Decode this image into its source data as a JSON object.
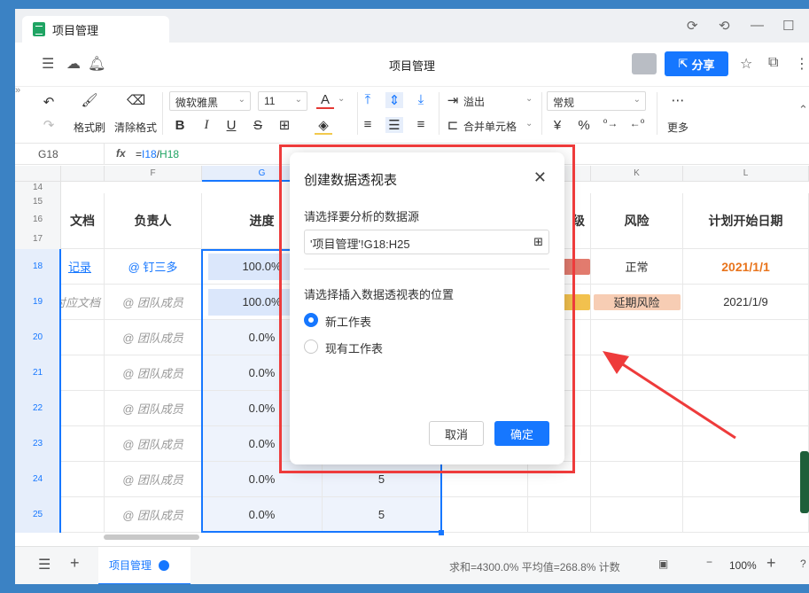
{
  "tab": {
    "title": "项目管理"
  },
  "doc": {
    "title": "项目管理",
    "share_label": "分享"
  },
  "toolbar": {
    "format_painter": "格式刷",
    "clear_format": "清除格式",
    "font": "微软雅黑",
    "size": "11",
    "overflow": "溢出",
    "merge": "合并单元格",
    "number_format": "常规",
    "more": "更多",
    "bold": "B",
    "italic": "I",
    "underline": "U",
    "strike": "S",
    "font_color_glyph": "A",
    "currency": "¥",
    "percent": "%"
  },
  "formula": {
    "cell_ref": "G18",
    "fx": "fx",
    "formula_prefix": "=",
    "formula_ref1": "I18",
    "formula_sep": "/",
    "formula_ref2": "H18"
  },
  "columns": {
    "f": "F",
    "g": "G",
    "k": "K",
    "l": "L"
  },
  "rows": {
    "r14": "14",
    "r15": "15",
    "r16": "16",
    "r17": "17",
    "r18": "18",
    "r19": "19",
    "r20": "20",
    "r21": "21",
    "r22": "22",
    "r23": "23",
    "r24": "24",
    "r25": "25"
  },
  "headers": {
    "doc": "文档",
    "owner": "负责人",
    "progress": "进度",
    "level": "级",
    "risk": "风险",
    "plan_start": "计划开始日期"
  },
  "cells": {
    "r18_doc": "记录",
    "r19_doc": "对应文档",
    "r18_owner": "@ 钉三多",
    "member": "@ 团队成员",
    "p100": "100.0%",
    "p0": "0.0%",
    "i_val": "5",
    "risk_normal": "正常",
    "risk_delay": "延期风险",
    "date1": "2021/1/1",
    "date2": "2021/1/9"
  },
  "status": {
    "sheet_tab": "项目管理",
    "summary": "求和=4300.0% 平均值=268.8% 计数",
    "zoom": "100%"
  },
  "dialog": {
    "title": "创建数据透视表",
    "source_label": "请选择要分析的数据源",
    "source_value": "'项目管理'!G18:H25",
    "position_label": "请选择插入数据透视表的位置",
    "option_new": "新工作表",
    "option_existing": "现有工作表",
    "cancel": "取消",
    "ok": "确定"
  },
  "colors": {
    "accent": "#1677ff",
    "annotation": "#ee3b3b",
    "date_highlight": "#e8741c"
  }
}
